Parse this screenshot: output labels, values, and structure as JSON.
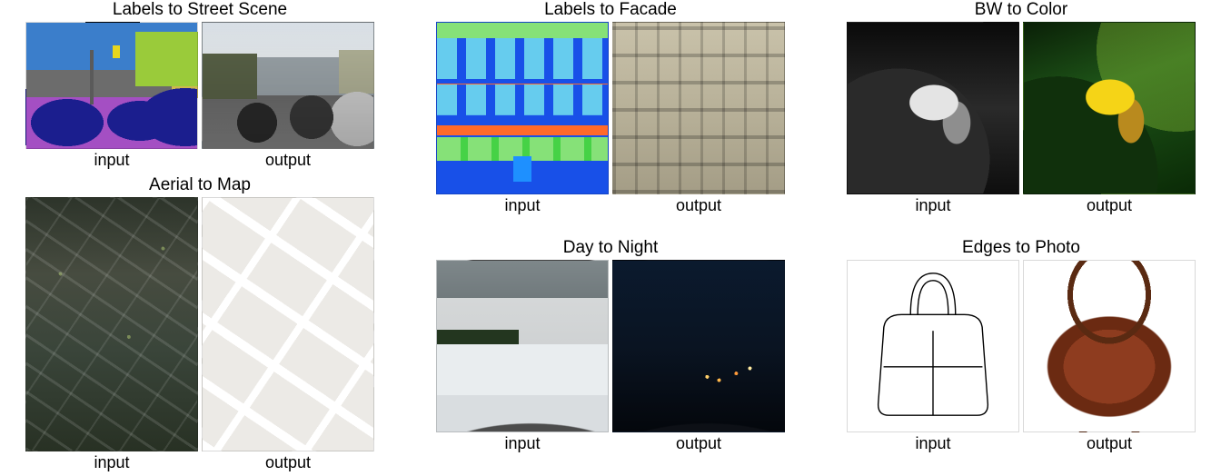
{
  "panels": {
    "street": {
      "title": "Labels to Street Scene",
      "in": "input",
      "out": "output"
    },
    "aerial": {
      "title": "Aerial to Map",
      "in": "input",
      "out": "output"
    },
    "facade": {
      "title": "Labels to Facade",
      "in": "input",
      "out": "output"
    },
    "bw": {
      "title": "BW to Color",
      "in": "input",
      "out": "output"
    },
    "day": {
      "title": "Day to Night",
      "in": "input",
      "out": "output"
    },
    "edges": {
      "title": "Edges to Photo",
      "in": "input",
      "out": "output"
    }
  }
}
